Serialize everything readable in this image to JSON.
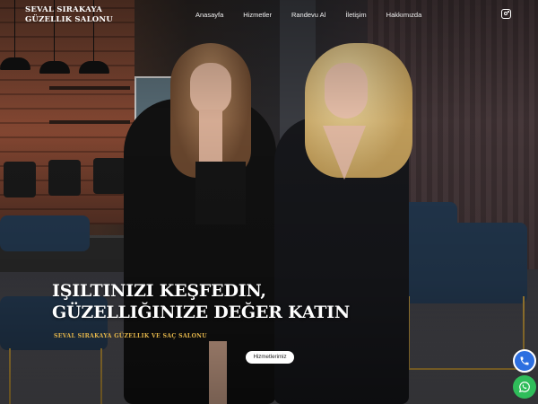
{
  "header": {
    "logo_line1": "SEVAL SIRAKAYA",
    "logo_line2": "GÜZELLIK SALONU",
    "nav": [
      {
        "label": "Anasayfa"
      },
      {
        "label": "Hizmetler"
      },
      {
        "label": "Randevu Al"
      },
      {
        "label": "İletişim"
      },
      {
        "label": "Hakkımızda"
      }
    ],
    "social_icon": "instagram-icon"
  },
  "hero": {
    "headline_line1": "IŞILTINIZI KEŞFEDIN,",
    "headline_line2": "GÜZELLIĞINIZE DEĞER KATIN",
    "subline": "SEVAL SIRAKAYA GÜZELLIK VE SAÇ SALONU",
    "cta_label": "Hizmetlerimiz"
  },
  "floating_actions": [
    {
      "icon": "phone-icon",
      "color": "#2d6fe0"
    },
    {
      "icon": "whatsapp-icon",
      "color": "#2fbd5a"
    }
  ],
  "colors": {
    "accent_gold": "#e3b54a",
    "text_white": "#ffffff"
  }
}
